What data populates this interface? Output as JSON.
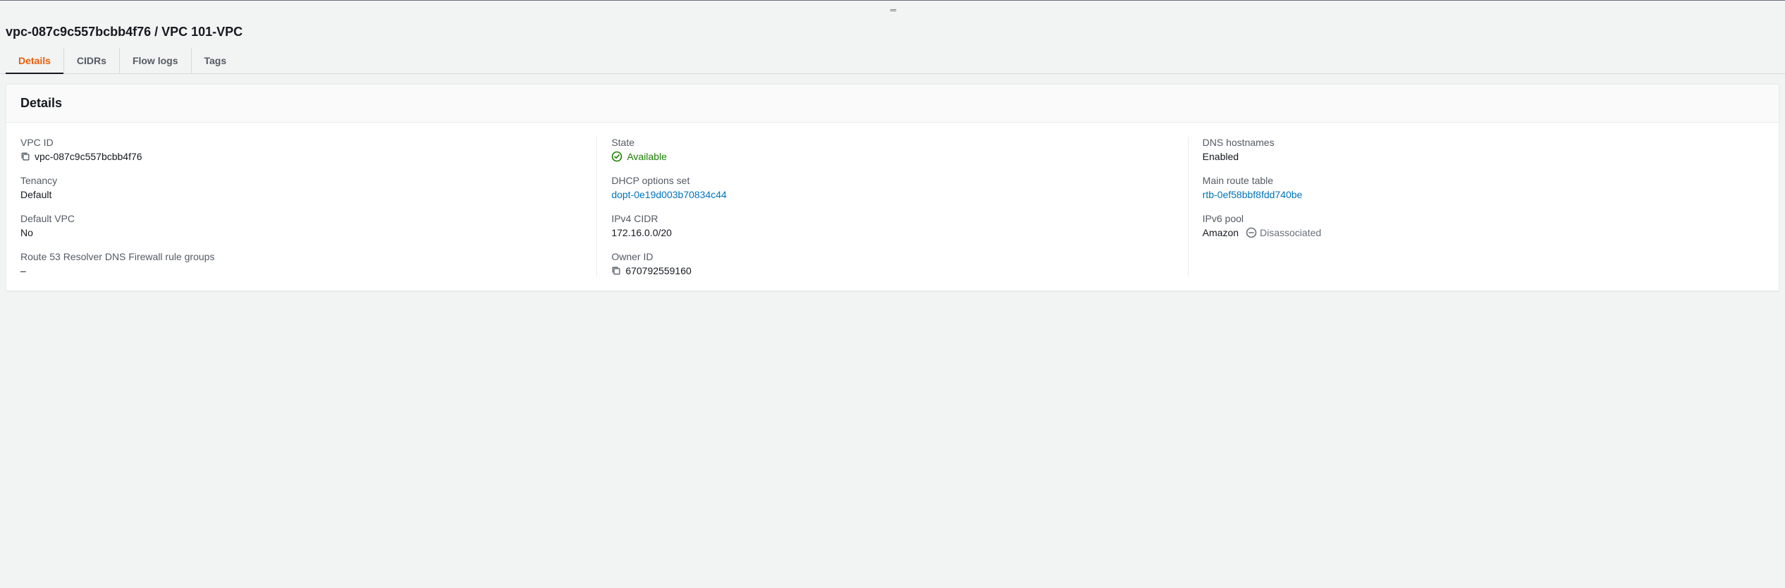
{
  "breadcrumb": "vpc-087c9c557bcbb4f76 / VPC 101-VPC",
  "tabs": {
    "details": "Details",
    "cidrs": "CIDRs",
    "flowlogs": "Flow logs",
    "tags": "Tags"
  },
  "panel": {
    "title": "Details"
  },
  "fields": {
    "vpc_id": {
      "label": "VPC ID",
      "value": "vpc-087c9c557bcbb4f76"
    },
    "state": {
      "label": "State",
      "value": "Available"
    },
    "dns_hostnames": {
      "label": "DNS hostnames",
      "value": "Enabled"
    },
    "tenancy": {
      "label": "Tenancy",
      "value": "Default"
    },
    "dhcp": {
      "label": "DHCP options set",
      "value": "dopt-0e19d003b70834c44"
    },
    "main_route_table": {
      "label": "Main route table",
      "value": "rtb-0ef58bbf8fdd740be"
    },
    "default_vpc": {
      "label": "Default VPC",
      "value": "No"
    },
    "ipv4_cidr": {
      "label": "IPv4 CIDR",
      "value": "172.16.0.0/20"
    },
    "ipv6_pool": {
      "label": "IPv6 pool",
      "value": "Amazon",
      "badge": "Disassociated"
    },
    "route53": {
      "label": "Route 53 Resolver DNS Firewall rule groups",
      "value": "–"
    },
    "owner_id": {
      "label": "Owner ID",
      "value": "670792559160"
    }
  }
}
